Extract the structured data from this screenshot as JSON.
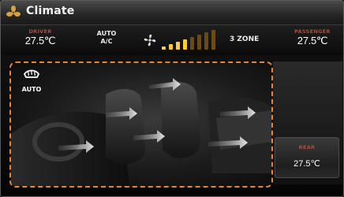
{
  "header": {
    "title": "Climate"
  },
  "status": {
    "driver_label": "DRIVER",
    "driver_temp": "27.5",
    "auto_ac_line1": "AUTO",
    "auto_ac_line2": "A/C",
    "fan_level": 4,
    "fan_max": 8,
    "zone_mode": "3 ZONE",
    "passenger_label": "PASSENGER",
    "passenger_temp": "27.5"
  },
  "temp_unit": "℃",
  "visual": {
    "auto_defrost_label": "AUTO"
  },
  "rear": {
    "label": "REAR",
    "temp": "27.5"
  },
  "colors": {
    "accent": "#e6843a",
    "label_red": "#b04a3a",
    "fan_on": "#ffcc33",
    "fan_off": "#6b4a1a"
  },
  "icons": {
    "logo": "fan-logo-icon",
    "fan": "fan-icon",
    "defrost": "defrost-icon",
    "airflow": "airflow-arrow-icon"
  }
}
